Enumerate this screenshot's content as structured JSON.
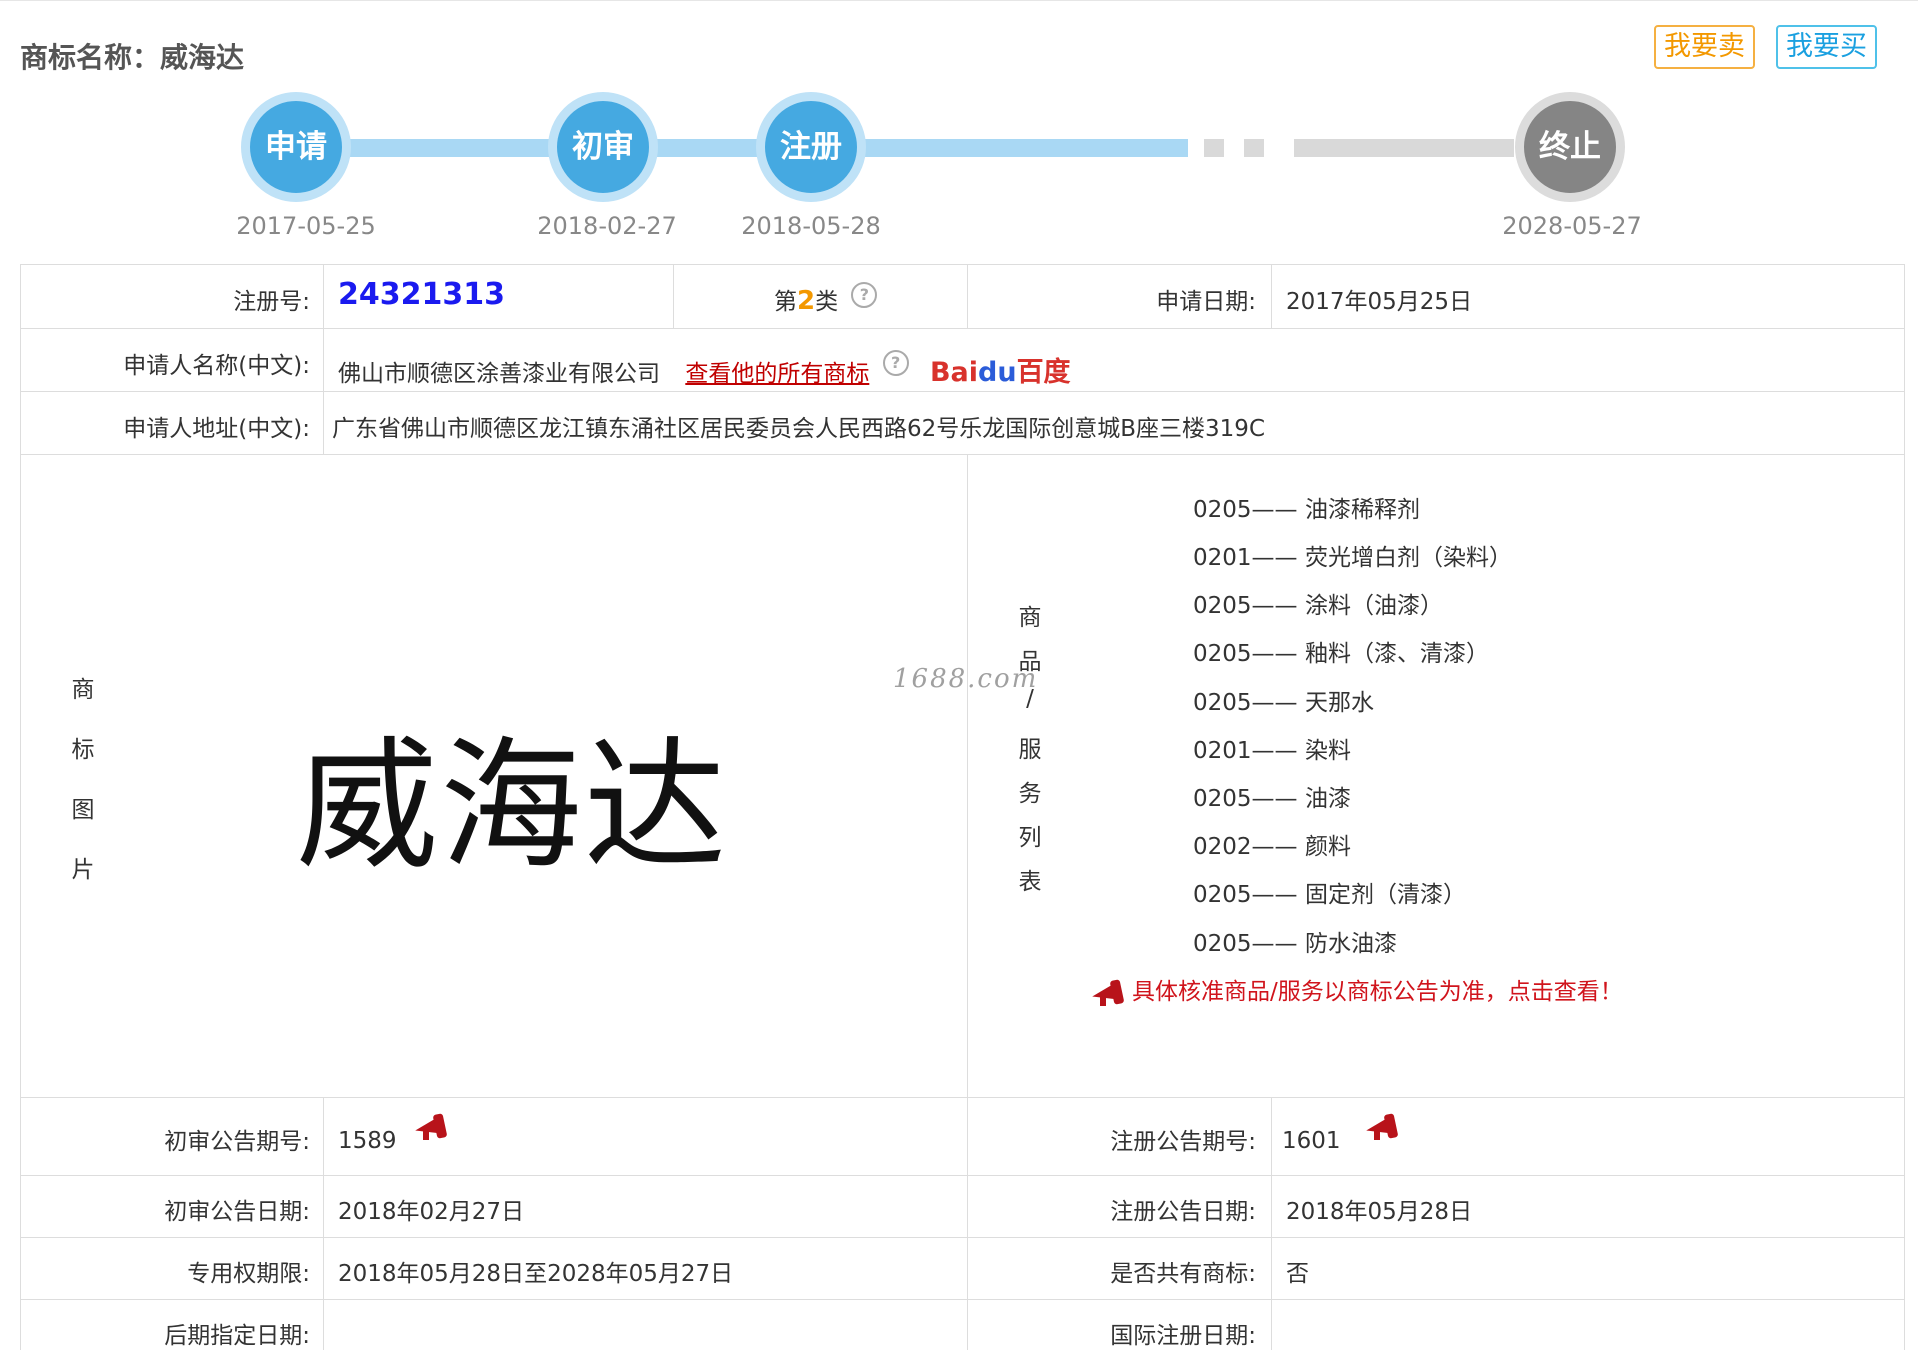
{
  "header": {
    "title": "商标名称：威海达",
    "sell_button": "我要卖",
    "buy_button": "我要买"
  },
  "timeline": {
    "steps": [
      {
        "label": "申请",
        "date": "2017-05-25",
        "state": "done"
      },
      {
        "label": "初审",
        "date": "2018-02-27",
        "state": "done"
      },
      {
        "label": "注册",
        "date": "2018-05-28",
        "state": "done"
      },
      {
        "label": "终止",
        "date": "2028-05-27",
        "state": "pending"
      }
    ]
  },
  "info": {
    "reg_no_label": "注册号:",
    "reg_no": "24321313",
    "class_prefix": "第",
    "class_num": "2",
    "class_suffix": "类",
    "help_icon": "?",
    "apply_date_label": "申请日期:",
    "apply_date": "2017年05月25日",
    "applicant_label": "申请人名称(中文):",
    "applicant": "佛山市顺德区涂善漆业有限公司",
    "view_all_link": "查看他的所有商标",
    "baidu_text_1": "Bai",
    "baidu_paw": "du",
    "baidu_text_2": "百度",
    "address_label": "申请人地址(中文):",
    "address": "广东省佛山市顺德区龙江镇东涌社区居民委员会人民西路62号乐龙国际创意城B座三楼319C"
  },
  "trademark": {
    "image_label_chars": [
      "商",
      "标",
      "图",
      "片"
    ],
    "image_text": "威海达",
    "watermark": "1688.com"
  },
  "goods": {
    "label_chars": [
      "商",
      "品",
      "/",
      "服",
      "务",
      "列",
      "表"
    ],
    "items": [
      {
        "code": "0205——",
        "name": "油漆稀释剂"
      },
      {
        "code": "0201——",
        "name": "荧光增白剂（染料）"
      },
      {
        "code": "0205——",
        "name": "涂料（油漆）"
      },
      {
        "code": "0205——",
        "name": "釉料（漆、清漆）"
      },
      {
        "code": "0205——",
        "name": "天那水"
      },
      {
        "code": "0201——",
        "name": "染料"
      },
      {
        "code": "0205——",
        "name": "油漆"
      },
      {
        "code": "0202——",
        "name": "颜料"
      },
      {
        "code": "0205——",
        "name": "固定剂（清漆）"
      },
      {
        "code": "0205——",
        "name": "防水油漆"
      }
    ],
    "notice": "具体核准商品/服务以商标公告为准，点击查看！"
  },
  "announcements": {
    "prelim_no_label": "初审公告期号:",
    "prelim_no": "1589",
    "reg_no_label": "注册公告期号:",
    "reg_no": "1601",
    "prelim_date_label": "初审公告日期:",
    "prelim_date": "2018年02月27日",
    "reg_date_label": "注册公告日期:",
    "reg_date": "2018年05月28日",
    "exclusive_label": "专用权期限:",
    "exclusive": "2018年05月28日至2028年05月27日",
    "shared_label": "是否共有商标:",
    "shared": "否",
    "later_label": "后期指定日期:",
    "later": "",
    "intl_label": "国际注册日期:",
    "intl": ""
  },
  "colors": {
    "accent_blue": "#45a9e1",
    "sell_orange": "#f39800",
    "buy_cyan": "#1aa0e0",
    "notice_red": "#d0141c"
  }
}
